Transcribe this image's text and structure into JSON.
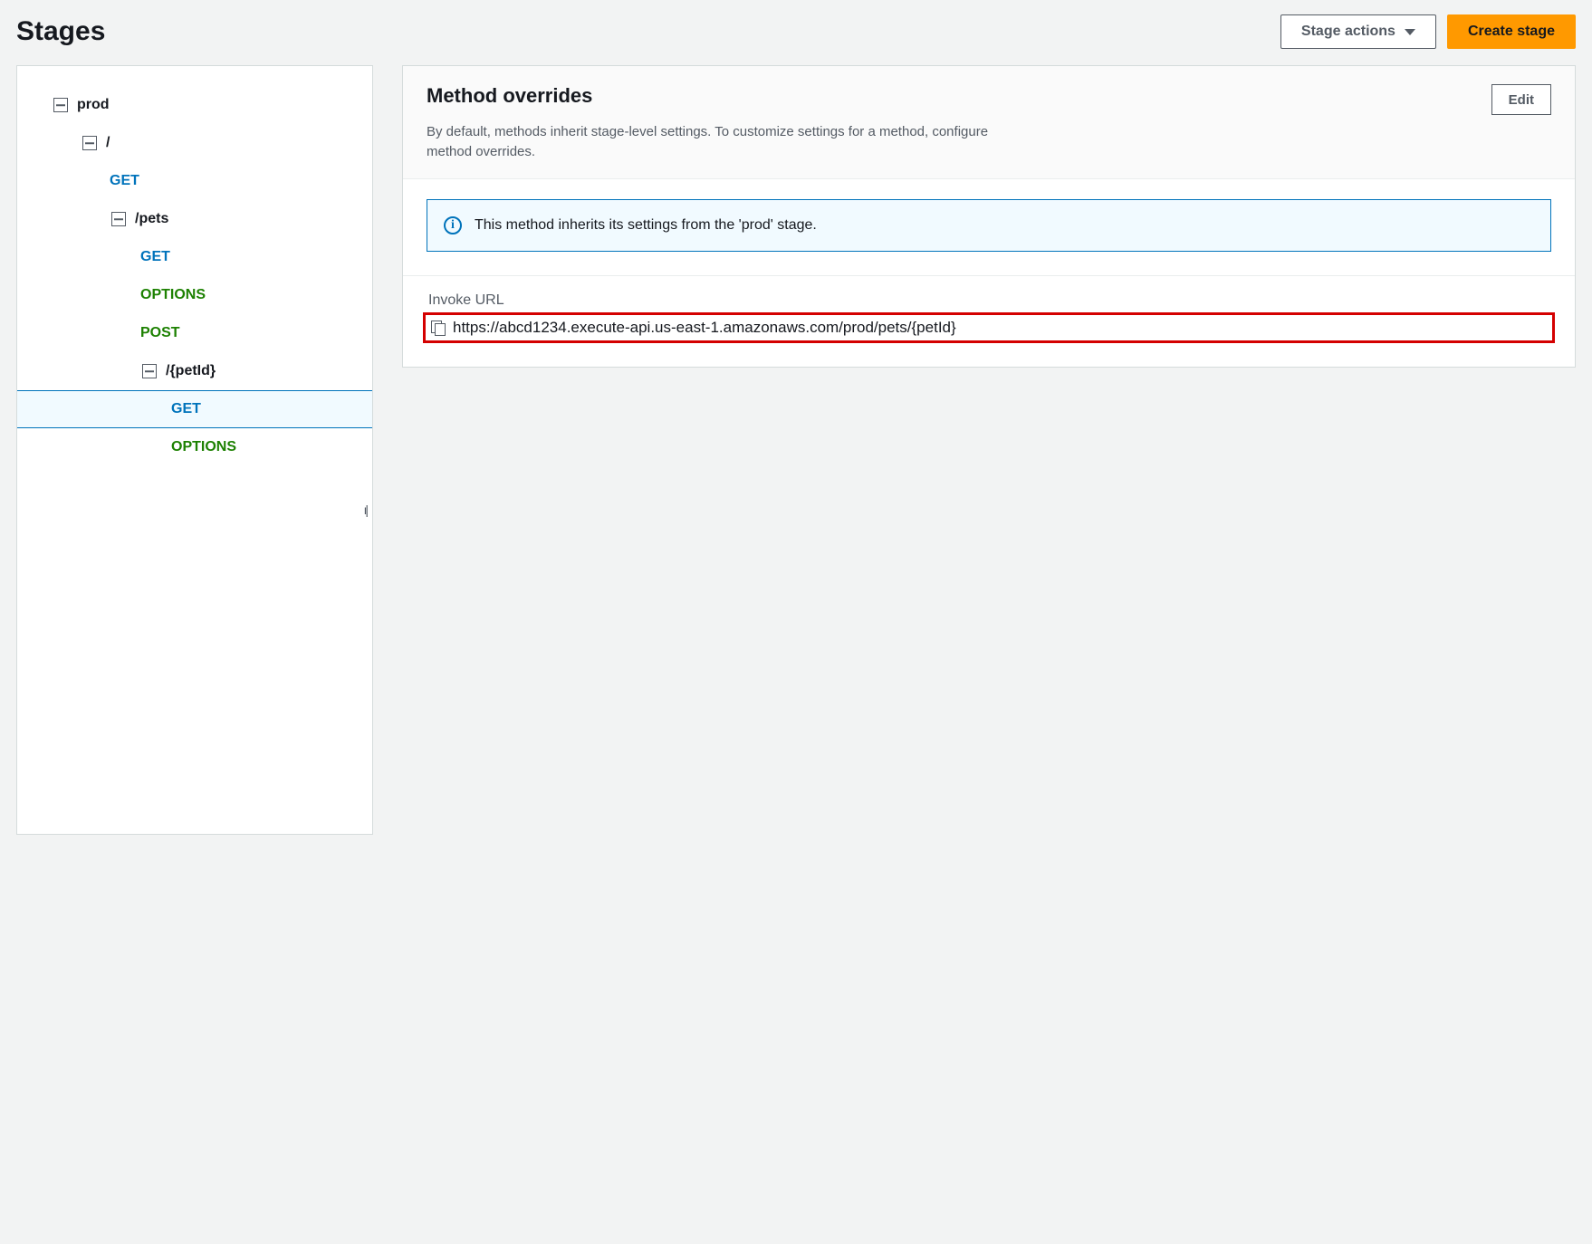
{
  "header": {
    "title": "Stages",
    "stage_actions_label": "Stage actions",
    "create_stage_label": "Create stage"
  },
  "tree": {
    "stage_name": "prod",
    "root": "/",
    "root_children": [
      {
        "label": "GET",
        "type": "method",
        "kind": "get"
      }
    ],
    "pets": {
      "path": "/pets",
      "children": [
        {
          "label": "GET",
          "kind": "get"
        },
        {
          "label": "OPTIONS",
          "kind": "options"
        },
        {
          "label": "POST",
          "kind": "post"
        }
      ],
      "petId": {
        "path": "/{petId}",
        "children": [
          {
            "label": "GET",
            "kind": "get",
            "selected": true
          },
          {
            "label": "OPTIONS",
            "kind": "options"
          }
        ]
      }
    }
  },
  "detail": {
    "title": "Method overrides",
    "edit_label": "Edit",
    "description": "By default, methods inherit stage-level settings. To customize settings for a method, configure method overrides.",
    "info_message": "This method inherits its settings from the 'prod' stage.",
    "invoke_url_label": "Invoke URL",
    "invoke_url": "https://abcd1234.execute-api.us-east-1.amazonaws.com/prod/pets/{petId}"
  }
}
